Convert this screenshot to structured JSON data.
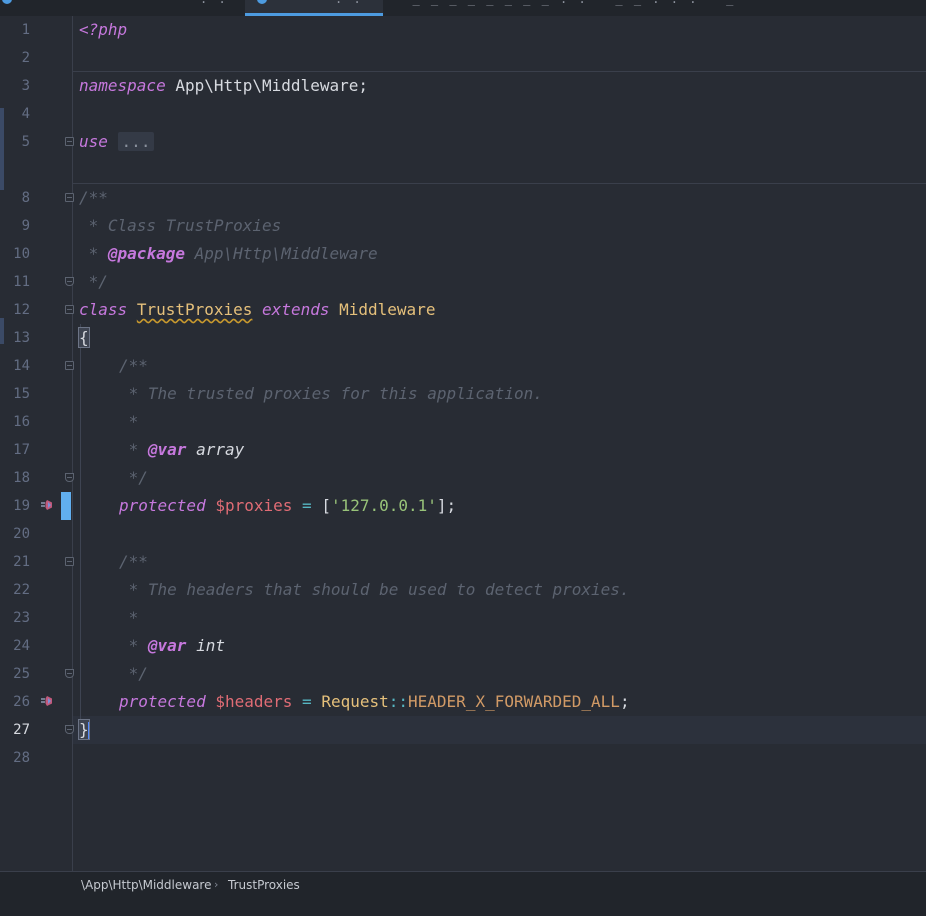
{
  "editor": {
    "lines": {
      "l1": "<?php",
      "l3_kw": "namespace",
      "l3_ns": " App\\Http\\Middleware;",
      "l5_kw": "use",
      "l5_folded": "...",
      "l8": "/**",
      "l9": " * Class TrustProxies",
      "l10_pre": " * ",
      "l10_tag": "@package",
      "l10_val": " App\\Http\\Middleware",
      "l11": " */",
      "l12_kw": "class",
      "l12_name": "TrustProxies",
      "l12_ext": "extends",
      "l12_parent": "Middleware",
      "l13": "{",
      "l14": "/**",
      "l15": " * The trusted proxies for this application.",
      "l16": " *",
      "l17_pre": " * ",
      "l17_tag": "@var",
      "l17_type": " array",
      "l18": " */",
      "l19_kw": "protected",
      "l19_var": "$proxies",
      "l19_eq": " = ",
      "l19_open": "[",
      "l19_str": "'127.0.0.1'",
      "l19_close": "];",
      "l21": "/**",
      "l22": " * The headers that should be used to detect proxies.",
      "l23": " *",
      "l24_pre": " * ",
      "l24_tag": "@var",
      "l24_type": " int",
      "l25": " */",
      "l26_kw": "protected",
      "l26_var": "$headers",
      "l26_eq": " = ",
      "l26_class": "Request",
      "l26_op": "::",
      "l26_const": "HEADER_X_FORWARDED_ALL",
      "l26_end": ";",
      "l27": "}"
    },
    "line_numbers": [
      "1",
      "2",
      "3",
      "4",
      "5",
      "8",
      "9",
      "10",
      "11",
      "12",
      "13",
      "14",
      "15",
      "16",
      "17",
      "18",
      "19",
      "20",
      "21",
      "22",
      "23",
      "24",
      "25",
      "26",
      "27",
      "28"
    ],
    "current_line": "27"
  },
  "breadcrumb": {
    "namespace": "\\App\\Http\\Middleware",
    "separator": "›",
    "class": "TrustProxies"
  },
  "colors": {
    "background": "#282c34",
    "keyword": "#c678dd",
    "class_name": "#e5c07b",
    "variable": "#e06c75",
    "string": "#98c379",
    "constant": "#d19a66",
    "comment": "#5c6370",
    "active_tab": "#4d9be0"
  },
  "icons": [
    "override-icon",
    "fold-icon",
    "php-file-icon"
  ]
}
